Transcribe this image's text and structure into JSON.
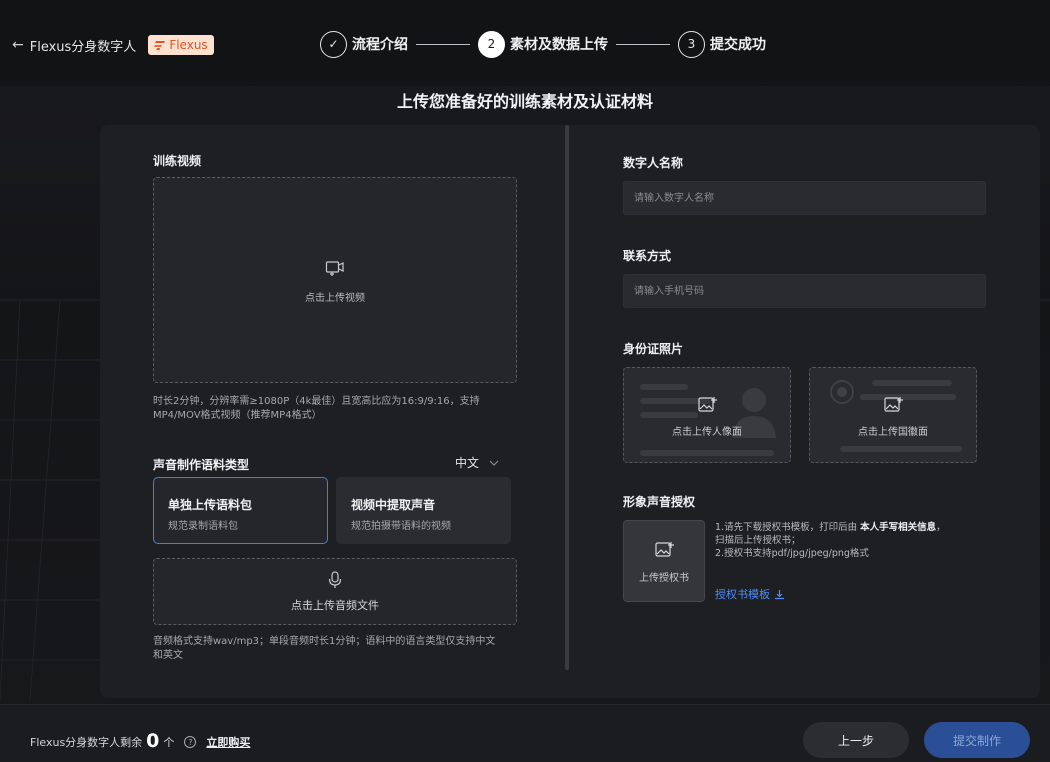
{
  "header": {
    "back_label": "Flexus分身数字人",
    "badge_label": "Flexus",
    "steps": [
      {
        "index": "✓",
        "label": "流程介绍"
      },
      {
        "index": "2",
        "label": "素材及数据上传"
      },
      {
        "index": "3",
        "label": "提交成功"
      }
    ]
  },
  "page_title": "上传您准备好的训练素材及认证材料",
  "left": {
    "video_label": "训练视频",
    "video_upload_text": "点击上传视频",
    "video_hint_line1": "时长2分钟，分辨率需≥1080P（4k最佳）且宽高比应为16:9/9:16，支持",
    "video_hint_line2": "MP4/MOV格式视频（推荐MP4格式）",
    "voice_type_label": "声音制作语料类型",
    "language_value": "中文",
    "options": [
      {
        "title": "单独上传语料包",
        "subtitle": "规范录制语料包"
      },
      {
        "title": "视频中提取声音",
        "subtitle": "规范拍摄带语料的视频"
      }
    ],
    "audio_upload_text": "点击上传音频文件",
    "audio_hint_line1": "音频格式支持wav/mp3；单段音频时长1分钟；语料中的语言类型仅支持中文",
    "audio_hint_line2": "和英文"
  },
  "right": {
    "name_label": "数字人名称",
    "name_placeholder": "请输入数字人名称",
    "contact_label": "联系方式",
    "contact_placeholder": "请输入手机号码",
    "id_label": "身份证照片",
    "id_front_text": "点击上传人像面",
    "id_back_text": "点击上传国徽面",
    "auth_label": "形象声音授权",
    "auth_upload_text": "上传授权书",
    "auth_line1_prefix": "1.请先下载授权书模板，打印后由",
    "auth_line1_bold": "本人手写相关信息",
    "auth_line1_suffix": "，",
    "auth_line2": "扫描后上传授权书；",
    "auth_line3": "2.授权书支持pdf/jpg/jpeg/png格式",
    "auth_template_link": "授权书模板"
  },
  "footer": {
    "quota_prefix": "Flexus分身数字人剩余",
    "quota_count": "0",
    "quota_unit": "个",
    "help_glyph": "?",
    "buy_label": "立即购买",
    "prev_label": "上一步",
    "submit_label": "提交制作"
  },
  "colors": {
    "accent": "#3c7ef5",
    "link": "#4d8df7",
    "submit_bg": "#2a4f96",
    "badge_bg": "#fde3cf",
    "badge_text": "#e2522c"
  }
}
